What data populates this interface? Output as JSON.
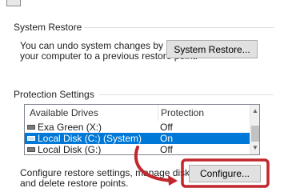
{
  "system_restore": {
    "title": "System Restore",
    "description_line1": "You can undo system changes by reverting",
    "description_line2": "your computer to a previous restore point.",
    "button_label": "System Restore..."
  },
  "protection_settings": {
    "title": "Protection Settings",
    "columns": [
      "Available Drives",
      "Protection"
    ],
    "drives": [
      {
        "name": "Exa Green (X:)",
        "protection": "Off",
        "selected": false
      },
      {
        "name": "Local Disk (C:) (System)",
        "protection": "On",
        "selected": true
      },
      {
        "name": "Local Disk (G:)",
        "protection": "Off",
        "selected": false
      }
    ],
    "configure_line1": "Configure restore settings, manage disk space,",
    "configure_line2": "and delete restore points.",
    "configure_button_label": "Configure..."
  },
  "annotation": {
    "arrow_color": "#c1272d"
  }
}
